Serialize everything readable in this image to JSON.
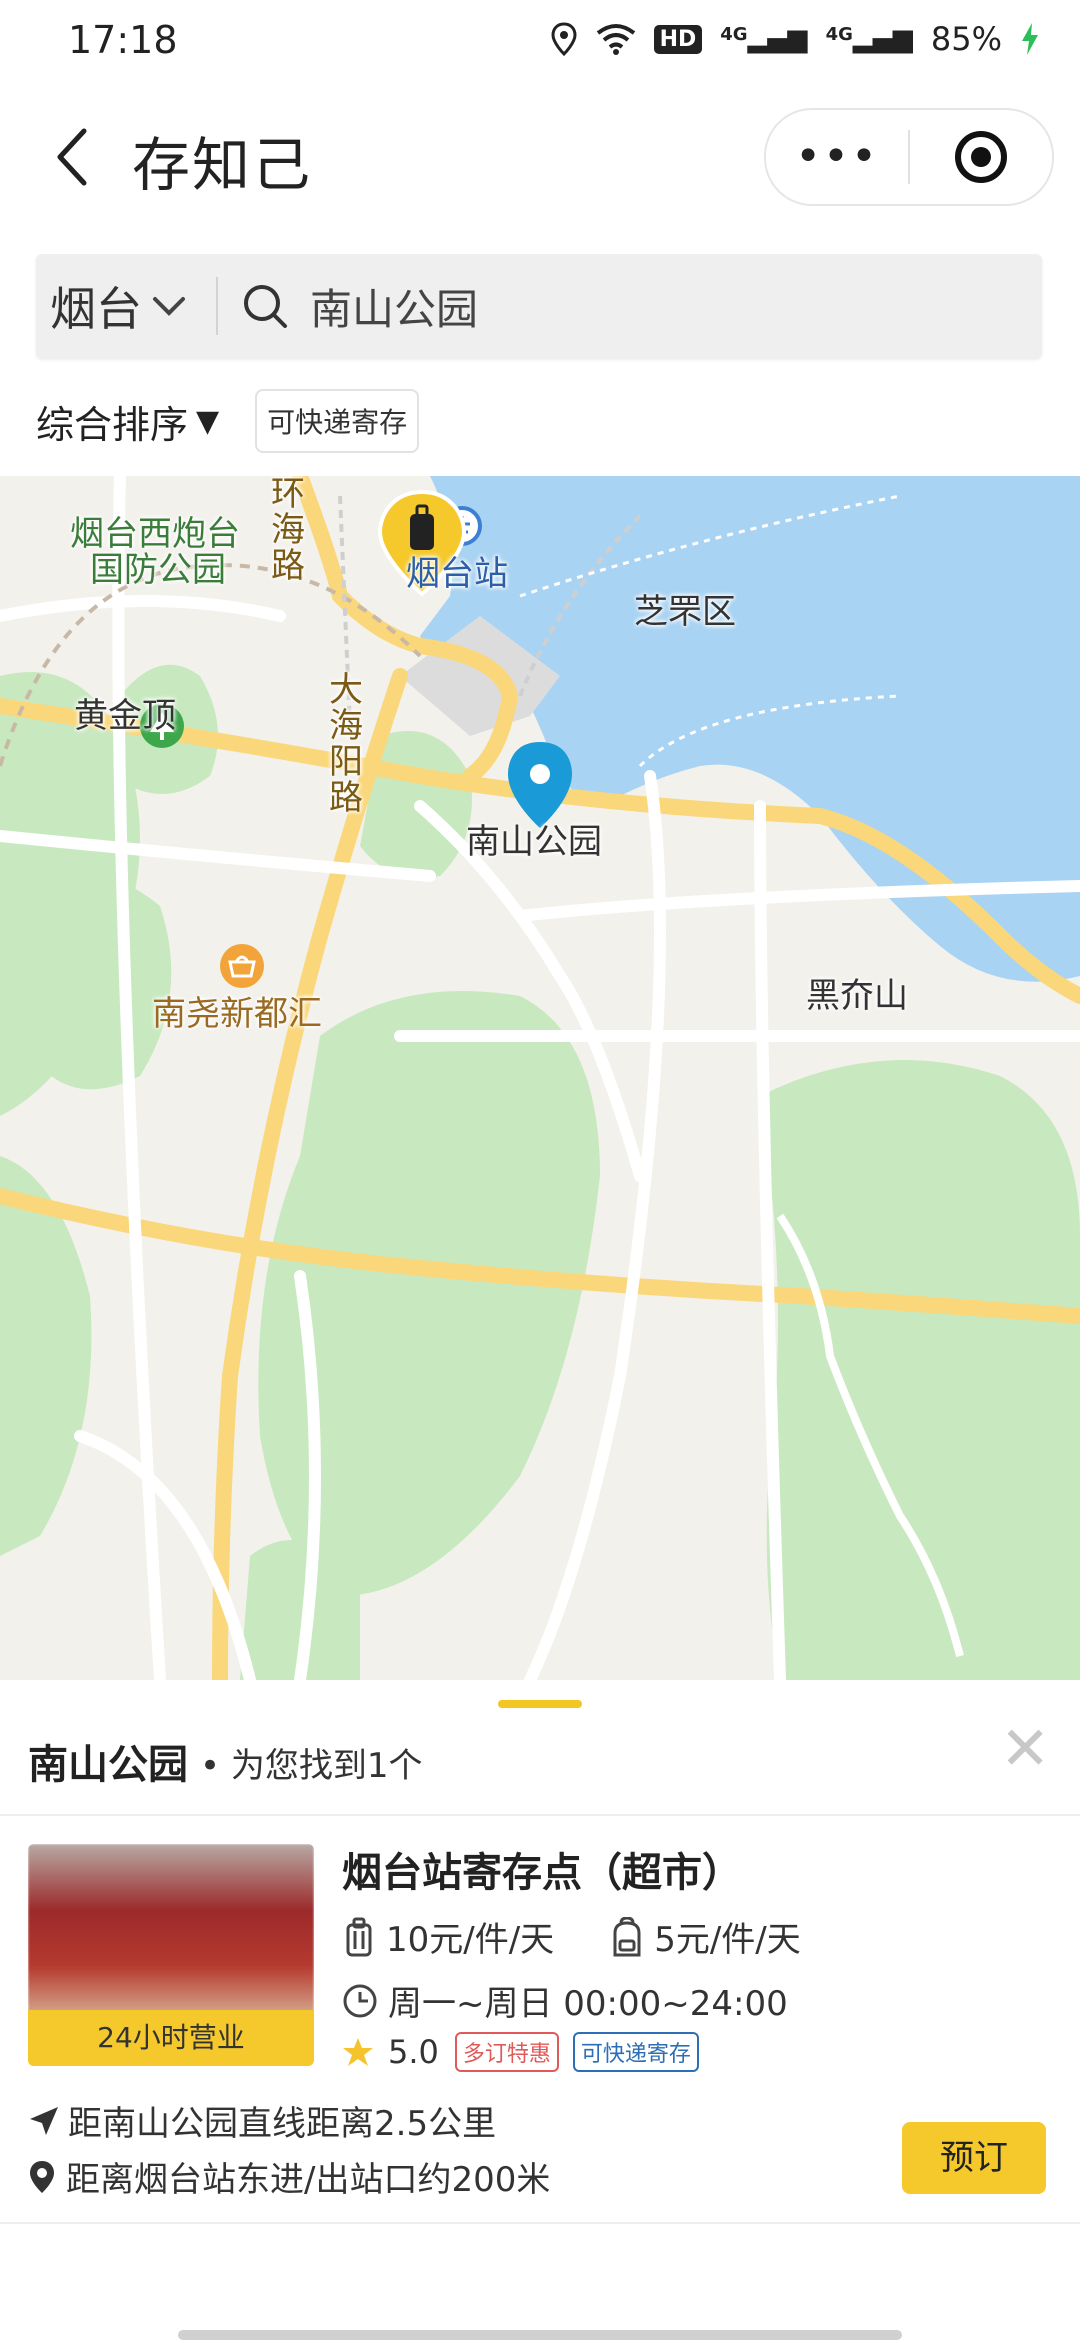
{
  "status_bar": {
    "time": "17:18",
    "hd_badge": "HD",
    "signal1": "4G",
    "signal2": "4G",
    "battery": "85%"
  },
  "header": {
    "title": "存知己",
    "more_label": "•••"
  },
  "search": {
    "city": "烟台",
    "query": "南山公园"
  },
  "filter": {
    "sort_label": "综合排序",
    "express_chip": "可快递寄存"
  },
  "map": {
    "labels": {
      "huanhai_road": "环海路",
      "xipaotai": "烟台西炮台",
      "guofang": "国防公园",
      "yantai_station": "烟台站",
      "zhifu": "芝罘区",
      "huangjinding": "黄金顶",
      "dahaiyang_road": "大海阳路",
      "nanshan_park": "南山公园",
      "heijieshan": "黑夼山",
      "nanyao": "南尧新都汇"
    }
  },
  "result": {
    "title": "南山公园",
    "bullet": "•",
    "subtitle": "为您找到1个",
    "close": "✕"
  },
  "store": {
    "image_badge": "24小时营业",
    "name": "烟台站寄存点（超市）",
    "price_large": "10元/件/天",
    "price_small": "5元/件/天",
    "hours": "周一~周日 00:00~24:00",
    "rating": "5.0",
    "tag_discount": "多订特惠",
    "tag_express": "可快递寄存",
    "distance_straight": "距南山公园直线距离2.5公里",
    "direction": "距离烟台站东进/出站口约200米",
    "book_label": "预订"
  },
  "colors": {
    "accent_yellow": "#f5c92c",
    "map_sea": "#a9d3f3",
    "map_park": "#c8e9bf",
    "map_road": "#fad77a",
    "marker_blue": "#1a9ad6"
  }
}
